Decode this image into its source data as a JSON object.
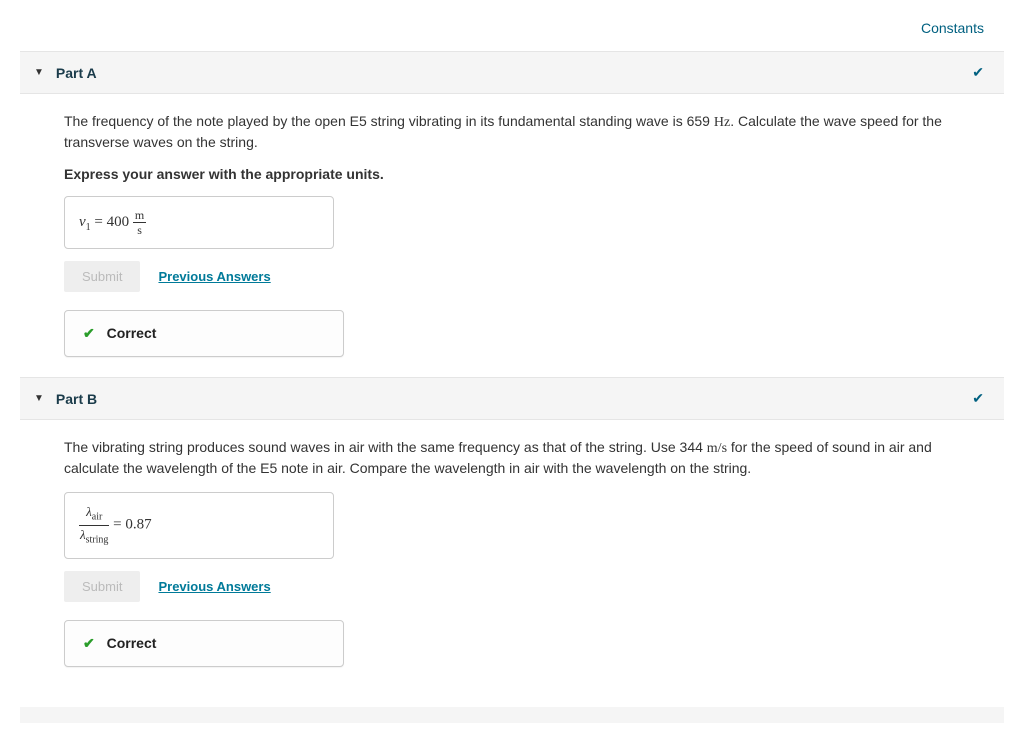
{
  "topLinks": {
    "constants": "Constants"
  },
  "parts": {
    "a": {
      "title": "Part A",
      "prompt": "The frequency of the note played by the open E5 string vibrating in its fundamental standing wave is 659 Hz. Calculate the wave speed for the transverse waves on the string.",
      "instruction": "Express your answer with the appropriate units.",
      "answer": {
        "lhs_var": "v",
        "lhs_sub": "1",
        "eq": " = ",
        "value": " 400 ",
        "unit_top": "m",
        "unit_bot": "s"
      },
      "submit": "Submit",
      "prev": "Previous Answers",
      "correct": "Correct"
    },
    "b": {
      "title": "Part B",
      "prompt": "The vibrating string produces sound waves in air with the same frequency as that of the string. Use 344 m/s for the speed of sound in air and calculate the wavelength of the E5 note in air. Compare the wavelength in air with the wavelength on the string.",
      "answer": {
        "lhs_top_var": "λ",
        "lhs_top_sub": "air",
        "lhs_bot_var": "λ",
        "lhs_bot_sub": "string",
        "eq": " = ",
        "value": " 0.87"
      },
      "submit": "Submit",
      "prev": "Previous Answers",
      "correct": "Correct"
    }
  }
}
